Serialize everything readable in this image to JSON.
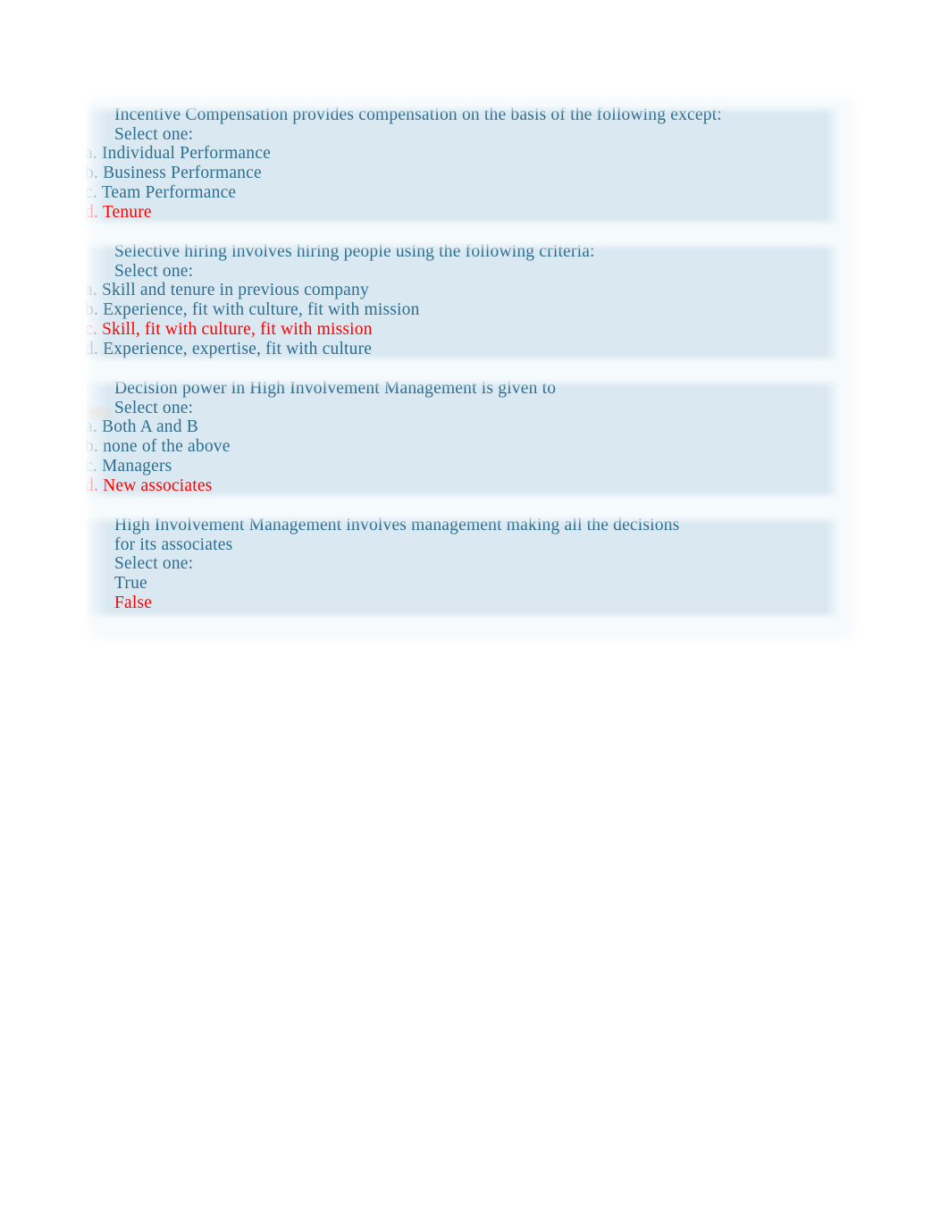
{
  "document": {
    "title": "Quiz Review",
    "accent_blue": "#2e6e8e",
    "selected_red": "#ff0000",
    "block_background": "#d9e8f1",
    "page_background": "#ffffff"
  },
  "select_one_label": "Select one:",
  "questions": [
    {
      "id": "q1",
      "stem": "Incentive Compensation provides compensation on the basis of the following except:",
      "prompt": "Select one:",
      "options": [
        {
          "label": "a. Individual Performance",
          "selected": false
        },
        {
          "label": "b. Business Performance",
          "selected": false
        },
        {
          "label": "c. Team Performance",
          "selected": false
        },
        {
          "label": "d. Tenure",
          "selected": true
        }
      ]
    },
    {
      "id": "q2",
      "stem": "Selective hiring involves hiring people using the following criteria:",
      "prompt": "Select one:",
      "options": [
        {
          "label": "a. Skill and tenure in previous company",
          "selected": false
        },
        {
          "label": "b. Experience, fit with culture, fit with mission",
          "selected": false
        },
        {
          "label": "c. Skill, fit with culture, fit with mission",
          "selected": true
        },
        {
          "label": "d. Experience, expertise, fit with culture",
          "selected": false
        }
      ]
    },
    {
      "id": "q3",
      "stem": "Decision power in High Involvement Management is given to",
      "prompt": "Select one:",
      "options": [
        {
          "label": "a. Both A and B",
          "selected": false
        },
        {
          "label": "b. none of the above",
          "selected": false
        },
        {
          "label": "c. Managers",
          "selected": false
        },
        {
          "label": "d. New associates",
          "selected": true
        }
      ]
    },
    {
      "id": "q4",
      "stem": "High Involvement Management involves management making all the decisions for its associates",
      "prompt": "Select one:",
      "options": [
        {
          "label": "True",
          "selected": false
        },
        {
          "label": "False",
          "selected": true
        }
      ]
    }
  ]
}
